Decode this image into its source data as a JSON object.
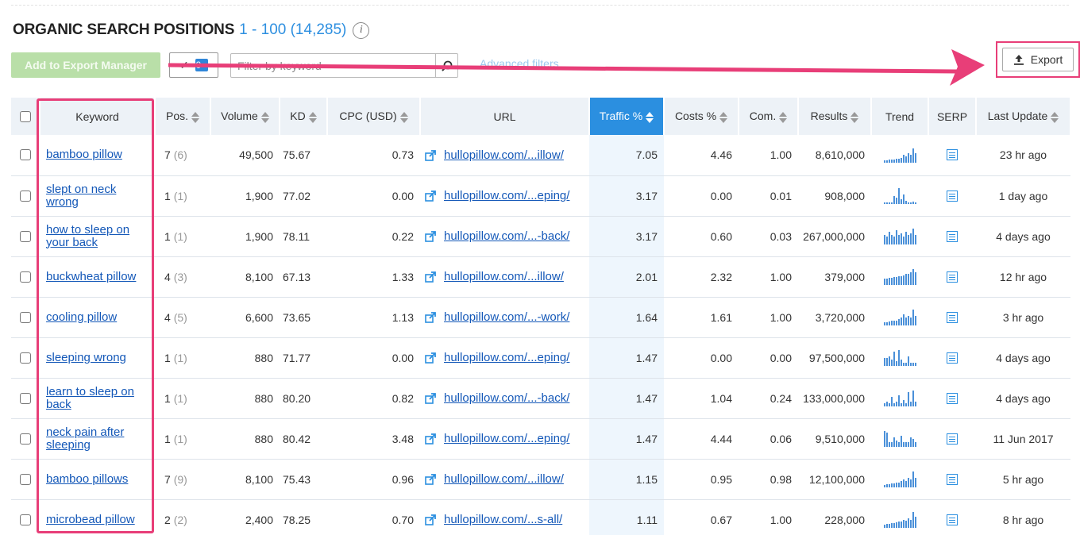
{
  "header": {
    "title": "ORGANIC SEARCH POSITIONS",
    "range": "1 - 100 (14,285)",
    "info": "i"
  },
  "toolbar": {
    "add_export_label": "Add to Export Manager",
    "selected_count": "0",
    "filter_placeholder": "Filter by keyword",
    "advanced_filters": "Advanced filters",
    "export_label": "Export"
  },
  "colors": {
    "accent_blue": "#2b8fe0",
    "link_blue": "#1458b8",
    "highlight_pink": "#e83e78",
    "add_button_green": "#b9dfa8"
  },
  "table": {
    "columns": [
      "Keyword",
      "Pos.",
      "Volume",
      "KD",
      "CPC (USD)",
      "URL",
      "Traffic %",
      "Costs %",
      "Com.",
      "Results",
      "Trend",
      "SERP",
      "Last Update"
    ],
    "rows": [
      {
        "keyword": "bamboo pillow",
        "pos": "7",
        "pos_prev": "(6)",
        "volume": "49,500",
        "kd": "75.67",
        "cpc": "0.73",
        "url": "hullopillow.com/...illow/",
        "traffic": "7.05",
        "costs": "4.46",
        "com": "1.00",
        "results": "8,610,000",
        "trend": [
          0.15,
          0.15,
          0.2,
          0.2,
          0.2,
          0.25,
          0.25,
          0.3,
          0.5,
          0.4,
          0.6,
          0.5,
          0.9,
          0.6
        ],
        "last_update": "23 hr ago"
      },
      {
        "keyword": "slept on neck wrong",
        "pos": "1",
        "pos_prev": "(1)",
        "volume": "1,900",
        "kd": "77.02",
        "cpc": "0.00",
        "url": "hullopillow.com/...eping/",
        "traffic": "3.17",
        "costs": "0.00",
        "com": "0.01",
        "results": "908,000",
        "trend": [
          0.1,
          0.1,
          0.1,
          0.1,
          0.5,
          0.4,
          1.0,
          0.3,
          0.6,
          0.2,
          0.1,
          0.1,
          0.15,
          0.1
        ],
        "last_update": "1 day ago"
      },
      {
        "keyword": "how to sleep on your back",
        "pos": "1",
        "pos_prev": "(1)",
        "volume": "1,900",
        "kd": "78.11",
        "cpc": "0.22",
        "url": "hullopillow.com/...-back/",
        "traffic": "3.17",
        "costs": "0.60",
        "com": "0.03",
        "results": "267,000,000",
        "trend": [
          0.6,
          0.5,
          0.8,
          0.6,
          0.5,
          0.9,
          0.6,
          0.7,
          0.5,
          0.8,
          0.6,
          0.7,
          1.0,
          0.6
        ],
        "last_update": "4 days ago"
      },
      {
        "keyword": "buckwheat pillow",
        "pos": "4",
        "pos_prev": "(3)",
        "volume": "8,100",
        "kd": "67.13",
        "cpc": "1.33",
        "url": "hullopillow.com/...illow/",
        "traffic": "2.01",
        "costs": "2.32",
        "com": "1.00",
        "results": "379,000",
        "trend": [
          0.4,
          0.4,
          0.45,
          0.45,
          0.5,
          0.5,
          0.55,
          0.55,
          0.6,
          0.7,
          0.7,
          0.8,
          1.0,
          0.8
        ],
        "last_update": "12 hr ago"
      },
      {
        "keyword": "cooling pillow",
        "pos": "4",
        "pos_prev": "(5)",
        "volume": "6,600",
        "kd": "73.65",
        "cpc": "1.13",
        "url": "hullopillow.com/...-work/",
        "traffic": "1.64",
        "costs": "1.61",
        "com": "1.00",
        "results": "3,720,000",
        "trend": [
          0.2,
          0.2,
          0.25,
          0.3,
          0.3,
          0.3,
          0.4,
          0.5,
          0.7,
          0.5,
          0.6,
          0.5,
          1.0,
          0.6
        ],
        "last_update": "3 hr ago"
      },
      {
        "keyword": "sleeping wrong",
        "pos": "1",
        "pos_prev": "(1)",
        "volume": "880",
        "kd": "71.77",
        "cpc": "0.00",
        "url": "hullopillow.com/...eping/",
        "traffic": "1.47",
        "costs": "0.00",
        "com": "0.00",
        "results": "97,500,000",
        "trend": [
          0.5,
          0.5,
          0.6,
          0.4,
          0.9,
          0.3,
          1.0,
          0.4,
          0.2,
          0.2,
          0.6,
          0.2,
          0.2,
          0.2
        ],
        "last_update": "4 days ago"
      },
      {
        "keyword": "learn to sleep on back",
        "pos": "1",
        "pos_prev": "(1)",
        "volume": "880",
        "kd": "80.20",
        "cpc": "0.82",
        "url": "hullopillow.com/...-back/",
        "traffic": "1.47",
        "costs": "1.04",
        "com": "0.24",
        "results": "133,000,000",
        "trend": [
          0.2,
          0.3,
          0.2,
          0.6,
          0.2,
          0.3,
          0.7,
          0.2,
          0.4,
          0.2,
          0.9,
          0.3,
          1.0,
          0.3
        ],
        "last_update": "4 days ago"
      },
      {
        "keyword": "neck pain after sleeping",
        "pos": "1",
        "pos_prev": "(1)",
        "volume": "880",
        "kd": "80.42",
        "cpc": "3.48",
        "url": "hullopillow.com/...eping/",
        "traffic": "1.47",
        "costs": "4.44",
        "com": "0.06",
        "results": "9,510,000",
        "trend": [
          1.0,
          0.9,
          0.3,
          0.3,
          0.6,
          0.4,
          0.3,
          0.7,
          0.3,
          0.3,
          0.3,
          0.6,
          0.5,
          0.3
        ],
        "last_update": "11 Jun 2017"
      },
      {
        "keyword": "bamboo pillows",
        "pos": "7",
        "pos_prev": "(9)",
        "volume": "8,100",
        "kd": "75.43",
        "cpc": "0.96",
        "url": "hullopillow.com/...illow/",
        "traffic": "1.15",
        "costs": "0.95",
        "com": "0.98",
        "results": "12,100,000",
        "trend": [
          0.15,
          0.2,
          0.2,
          0.25,
          0.25,
          0.3,
          0.3,
          0.4,
          0.5,
          0.4,
          0.6,
          0.5,
          1.0,
          0.6
        ],
        "last_update": "5 hr ago"
      },
      {
        "keyword": "microbead pillow",
        "pos": "2",
        "pos_prev": "(2)",
        "volume": "2,400",
        "kd": "78.25",
        "cpc": "0.70",
        "url": "hullopillow.com/...s-all/",
        "traffic": "1.11",
        "costs": "0.67",
        "com": "1.00",
        "results": "228,000",
        "trend": [
          0.2,
          0.25,
          0.25,
          0.3,
          0.3,
          0.35,
          0.4,
          0.4,
          0.5,
          0.45,
          0.6,
          0.5,
          1.0,
          0.7
        ],
        "last_update": "8 hr ago"
      }
    ]
  }
}
